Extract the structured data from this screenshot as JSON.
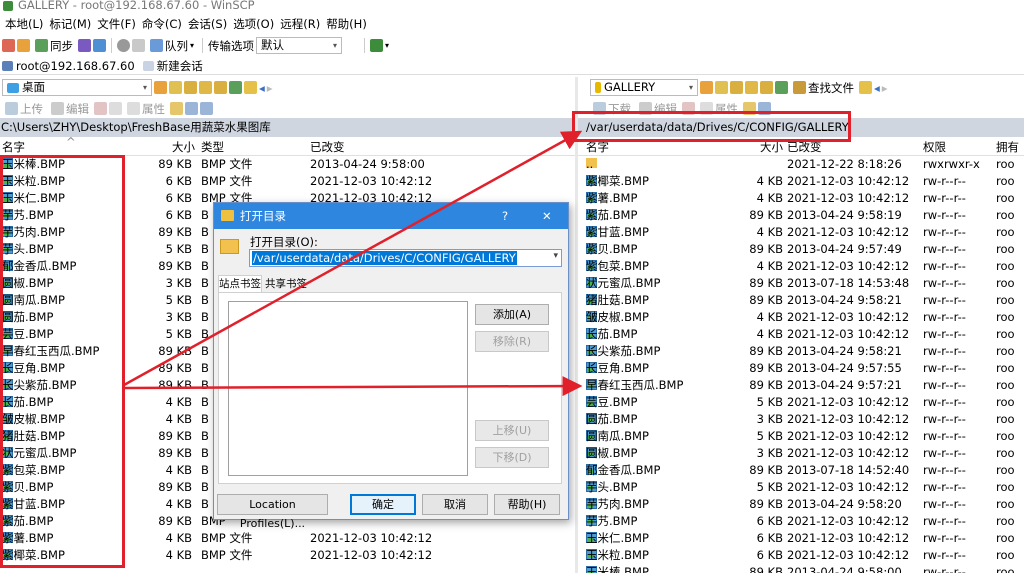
{
  "window": {
    "title": "GALLERY - root@192.168.67.60 - WinSCP"
  },
  "menu": [
    "本地(L)",
    "标记(M)",
    "文件(F)",
    "命令(C)",
    "会话(S)",
    "选项(O)",
    "远程(R)",
    "帮助(H)"
  ],
  "toolbar": {
    "sync": "同步",
    "queue": "队列",
    "transfer_label": "传输选项",
    "transfer_value": "默认"
  },
  "session": {
    "tab": "root@192.168.67.60",
    "new": "新建会话"
  },
  "local": {
    "drive": "桌面",
    "upload": "上传",
    "edit": "编辑",
    "props": "属性",
    "path": "C:\\Users\\ZHY\\Desktop\\FreshBase用蔬菜水果图库",
    "cols": {
      "name": "名字",
      "size": "大小",
      "type": "类型",
      "changed": "已改变"
    },
    "files": [
      {
        "name": "玉米棒.BMP",
        "size": "89 KB",
        "type": "BMP 文件",
        "date": "2013-04-24  9:58:00"
      },
      {
        "name": "玉米粒.BMP",
        "size": "6 KB",
        "type": "BMP 文件",
        "date": "2021-12-03  10:42:12"
      },
      {
        "name": "玉米仁.BMP",
        "size": "6 KB",
        "type": "BMP 文件",
        "date": "2021-12-03  10:42:12"
      },
      {
        "name": "芋艿.BMP",
        "size": "6 KB",
        "type": "B",
        "date": ""
      },
      {
        "name": "芋艿肉.BMP",
        "size": "89 KB",
        "type": "B",
        "date": ""
      },
      {
        "name": "芋头.BMP",
        "size": "5 KB",
        "type": "B",
        "date": ""
      },
      {
        "name": "郁金香瓜.BMP",
        "size": "89 KB",
        "type": "B",
        "date": ""
      },
      {
        "name": "圆椒.BMP",
        "size": "3 KB",
        "type": "B",
        "date": ""
      },
      {
        "name": "圆南瓜.BMP",
        "size": "5 KB",
        "type": "B",
        "date": ""
      },
      {
        "name": "圆茄.BMP",
        "size": "3 KB",
        "type": "B",
        "date": ""
      },
      {
        "name": "芸豆.BMP",
        "size": "5 KB",
        "type": "B",
        "date": ""
      },
      {
        "name": "早春红玉西瓜.BMP",
        "size": "89 KB",
        "type": "B",
        "date": ""
      },
      {
        "name": "长豆角.BMP",
        "size": "89 KB",
        "type": "B",
        "date": ""
      },
      {
        "name": "长尖紫茄.BMP",
        "size": "89 KB",
        "type": "B",
        "date": ""
      },
      {
        "name": "长茄.BMP",
        "size": "4 KB",
        "type": "B",
        "date": ""
      },
      {
        "name": "皱皮椒.BMP",
        "size": "4 KB",
        "type": "B",
        "date": ""
      },
      {
        "name": "猪肚菇.BMP",
        "size": "89 KB",
        "type": "B",
        "date": ""
      },
      {
        "name": "状元蜜瓜.BMP",
        "size": "89 KB",
        "type": "B",
        "date": ""
      },
      {
        "name": "紫包菜.BMP",
        "size": "4 KB",
        "type": "B",
        "date": ""
      },
      {
        "name": "紫贝.BMP",
        "size": "89 KB",
        "type": "B",
        "date": ""
      },
      {
        "name": "紫甘蓝.BMP",
        "size": "4 KB",
        "type": "B",
        "date": ""
      },
      {
        "name": "紫茄.BMP",
        "size": "89 KB",
        "type": "BMP",
        "date": ""
      },
      {
        "name": "紫薯.BMP",
        "size": "4 KB",
        "type": "BMP 文件",
        "date": "2021-12-03  10:42:12"
      },
      {
        "name": "紫椰菜.BMP",
        "size": "4 KB",
        "type": "BMP 文件",
        "date": "2021-12-03  10:42:12"
      }
    ]
  },
  "remote": {
    "folder": "GALLERY",
    "find": "查找文件",
    "download": "下载",
    "edit": "编辑",
    "props": "属性",
    "path": "/var/userdata/data/Drives/C/CONFIG/GALLERY",
    "cols": {
      "name": "名字",
      "size": "大小",
      "changed": "已改变",
      "rights": "权限",
      "owner": "拥有"
    },
    "files": [
      {
        "name": "..",
        "size": "",
        "date": "2021-12-22  8:18:26",
        "rights": "rwxrwxr-x",
        "owner": "roo"
      },
      {
        "name": "紫椰菜.BMP",
        "size": "4 KB",
        "date": "2021-12-03  10:42:12",
        "rights": "rw-r--r--",
        "owner": "roo"
      },
      {
        "name": "紫薯.BMP",
        "size": "4 KB",
        "date": "2021-12-03  10:42:12",
        "rights": "rw-r--r--",
        "owner": "roo"
      },
      {
        "name": "紫茄.BMP",
        "size": "89 KB",
        "date": "2013-04-24  9:58:19",
        "rights": "rw-r--r--",
        "owner": "roo"
      },
      {
        "name": "紫甘蓝.BMP",
        "size": "4 KB",
        "date": "2021-12-03  10:42:12",
        "rights": "rw-r--r--",
        "owner": "roo"
      },
      {
        "name": "紫贝.BMP",
        "size": "89 KB",
        "date": "2013-04-24  9:57:49",
        "rights": "rw-r--r--",
        "owner": "roo"
      },
      {
        "name": "紫包菜.BMP",
        "size": "4 KB",
        "date": "2021-12-03  10:42:12",
        "rights": "rw-r--r--",
        "owner": "roo"
      },
      {
        "name": "状元蜜瓜.BMP",
        "size": "89 KB",
        "date": "2013-07-18  14:53:48",
        "rights": "rw-r--r--",
        "owner": "roo"
      },
      {
        "name": "猪肚菇.BMP",
        "size": "89 KB",
        "date": "2013-04-24  9:58:21",
        "rights": "rw-r--r--",
        "owner": "roo"
      },
      {
        "name": "皱皮椒.BMP",
        "size": "4 KB",
        "date": "2021-12-03  10:42:12",
        "rights": "rw-r--r--",
        "owner": "roo"
      },
      {
        "name": "长茄.BMP",
        "size": "4 KB",
        "date": "2021-12-03  10:42:12",
        "rights": "rw-r--r--",
        "owner": "roo"
      },
      {
        "name": "长尖紫茄.BMP",
        "size": "89 KB",
        "date": "2013-04-24  9:58:21",
        "rights": "rw-r--r--",
        "owner": "roo"
      },
      {
        "name": "长豆角.BMP",
        "size": "89 KB",
        "date": "2013-04-24  9:57:55",
        "rights": "rw-r--r--",
        "owner": "roo"
      },
      {
        "name": "早春红玉西瓜.BMP",
        "size": "89 KB",
        "date": "2013-04-24  9:57:21",
        "rights": "rw-r--r--",
        "owner": "roo"
      },
      {
        "name": "芸豆.BMP",
        "size": "5 KB",
        "date": "2021-12-03  10:42:12",
        "rights": "rw-r--r--",
        "owner": "roo"
      },
      {
        "name": "圆茄.BMP",
        "size": "3 KB",
        "date": "2021-12-03  10:42:12",
        "rights": "rw-r--r--",
        "owner": "roo"
      },
      {
        "name": "圆南瓜.BMP",
        "size": "5 KB",
        "date": "2021-12-03  10:42:12",
        "rights": "rw-r--r--",
        "owner": "roo"
      },
      {
        "name": "圆椒.BMP",
        "size": "3 KB",
        "date": "2021-12-03  10:42:12",
        "rights": "rw-r--r--",
        "owner": "roo"
      },
      {
        "name": "郁金香瓜.BMP",
        "size": "89 KB",
        "date": "2013-07-18  14:52:40",
        "rights": "rw-r--r--",
        "owner": "roo"
      },
      {
        "name": "芋头.BMP",
        "size": "5 KB",
        "date": "2021-12-03  10:42:12",
        "rights": "rw-r--r--",
        "owner": "roo"
      },
      {
        "name": "芋艿肉.BMP",
        "size": "89 KB",
        "date": "2013-04-24  9:58:20",
        "rights": "rw-r--r--",
        "owner": "roo"
      },
      {
        "name": "芋艿.BMP",
        "size": "6 KB",
        "date": "2021-12-03  10:42:12",
        "rights": "rw-r--r--",
        "owner": "roo"
      },
      {
        "name": "玉米仁.BMP",
        "size": "6 KB",
        "date": "2021-12-03  10:42:12",
        "rights": "rw-r--r--",
        "owner": "roo"
      },
      {
        "name": "玉米粒.BMP",
        "size": "6 KB",
        "date": "2021-12-03  10:42:12",
        "rights": "rw-r--r--",
        "owner": "roo"
      },
      {
        "name": "玉米棒.BMP",
        "size": "89 KB",
        "date": "2013-04-24  9:58:00",
        "rights": "rw-r--r--",
        "owner": "roo"
      }
    ]
  },
  "dialog": {
    "title": "打开目录",
    "label": "打开目录(O):",
    "value": "/var/userdata/data/Drives/C/CONFIG/GALLERY",
    "tab1": "站点书签",
    "tab2": "共享书签",
    "add": "添加(A)",
    "remove": "移除(R)",
    "up": "上移(U)",
    "down": "下移(D)",
    "profiles": "Location Profiles(L)...",
    "ok": "确定",
    "cancel": "取消",
    "help": "帮助(H)",
    "help_glyph": "?",
    "close_glyph": "✕"
  },
  "colors": {
    "accent": "#2e86de",
    "annotation": "#e0202a",
    "pathbar": "#cfd6e0"
  }
}
